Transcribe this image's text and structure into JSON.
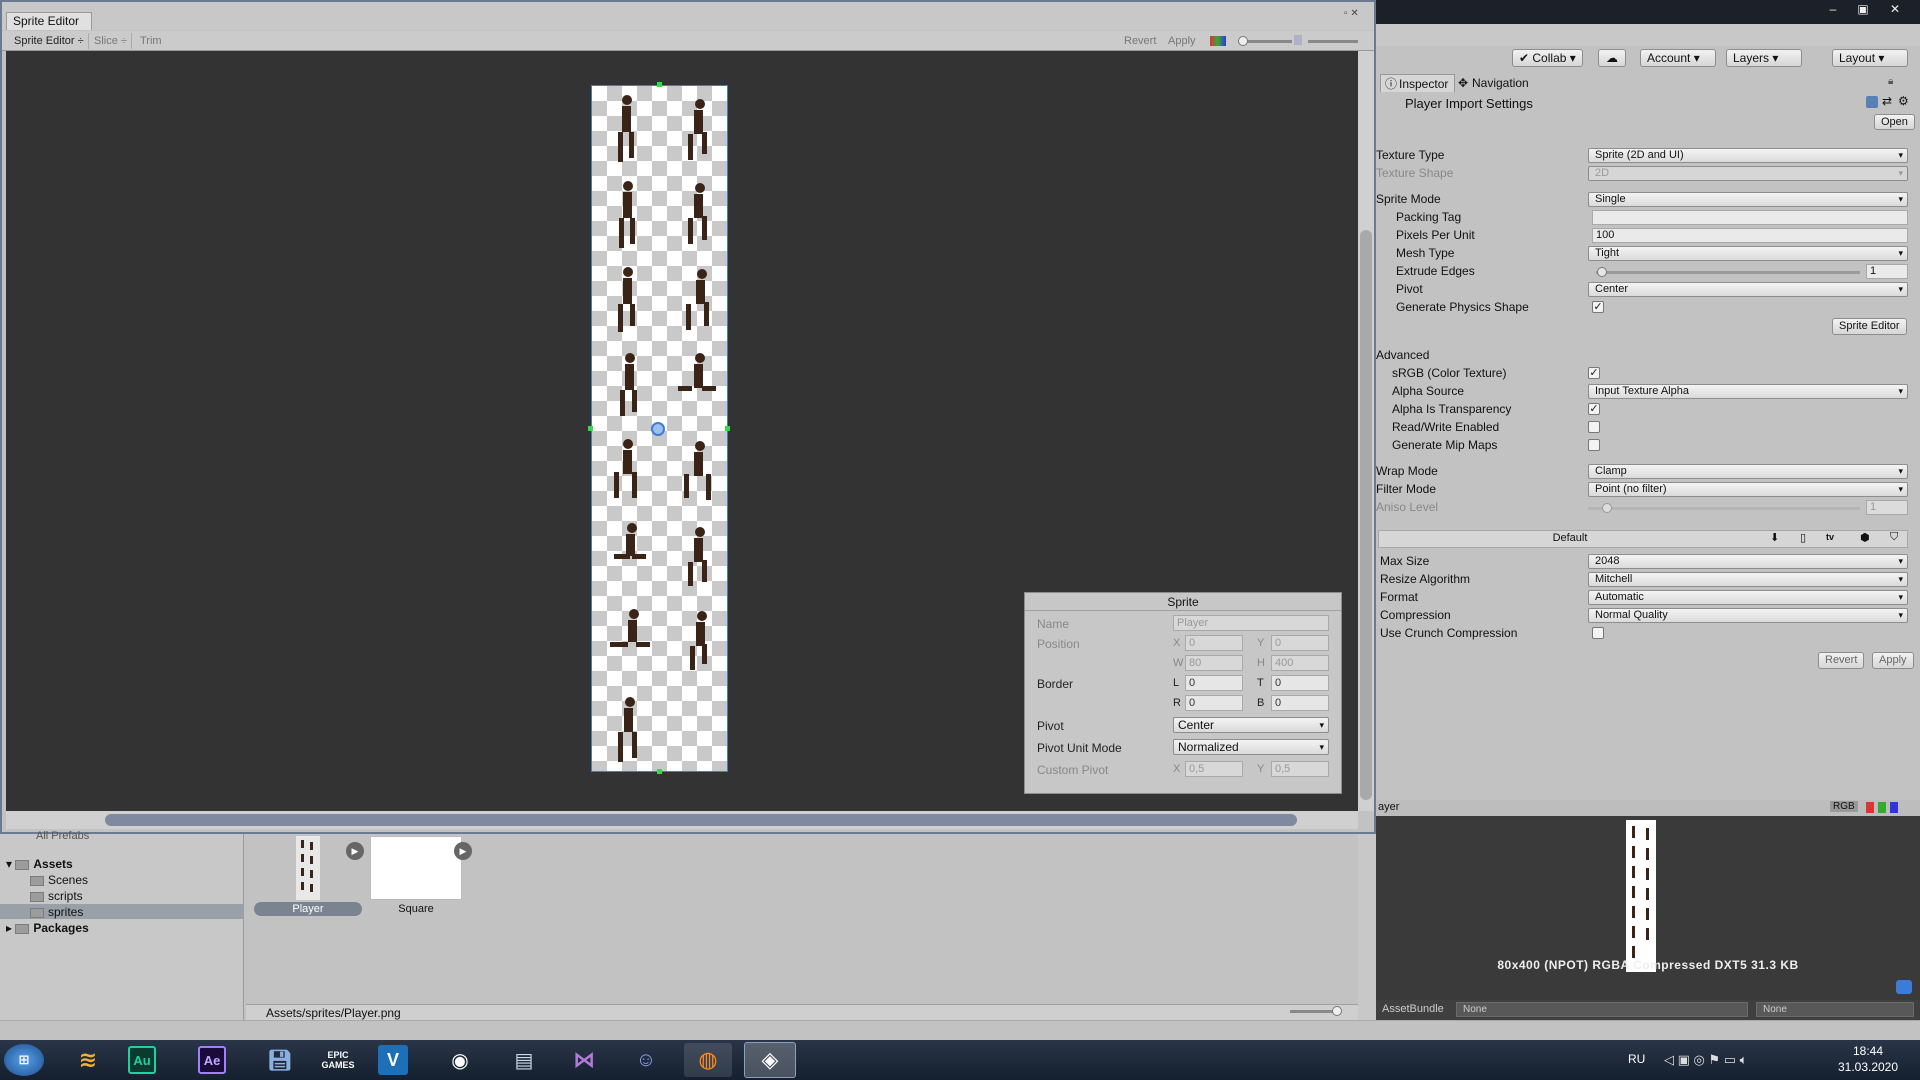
{
  "sprite_editor": {
    "tab_title": "Sprite Editor",
    "toolbar": {
      "mode": "Sprite Editor ÷",
      "slice": "Slice ÷",
      "trim": "Trim",
      "revert": "Revert",
      "apply": "Apply"
    },
    "sprite_panel": {
      "title": "Sprite",
      "name_label": "Name",
      "name_value": "Player",
      "position_label": "Position",
      "x_axis": "X",
      "x_value": "0",
      "y_axis": "Y",
      "y_value": "0",
      "w_axis": "W",
      "w_value": "80",
      "h_axis": "H",
      "h_value": "400",
      "border_label": "Border",
      "l_axis": "L",
      "l_value": "0",
      "t_axis": "T",
      "t_value": "0",
      "r_axis": "R",
      "r_value": "0",
      "b_axis": "B",
      "b_value": "0",
      "pivot_label": "Pivot",
      "pivot_value": "Center",
      "pivot_unit_label": "Pivot Unit Mode",
      "pivot_unit_value": "Normalized",
      "custom_pivot_label": "Custom Pivot",
      "cx_axis": "X",
      "cx_value": "0,5",
      "cy_axis": "Y",
      "cy_value": "0,5"
    }
  },
  "unity_toolbar": {
    "collab": "Collab ▾",
    "account": "Account ▾",
    "layers": "Layers ▾",
    "layout": "Layout ▾"
  },
  "inspector": {
    "tab_inspector": "Inspector",
    "tab_navigation": "Navigation",
    "title": "Player Import Settings",
    "open_button": "Open",
    "texture_type_label": "Texture Type",
    "texture_type_value": "Sprite (2D and UI)",
    "texture_shape_label": "Texture Shape",
    "texture_shape_value": "2D",
    "sprite_mode_label": "Sprite Mode",
    "sprite_mode_value": "Single",
    "packing_tag_label": "Packing Tag",
    "packing_tag_value": "",
    "ppu_label": "Pixels Per Unit",
    "ppu_value": "100",
    "mesh_type_label": "Mesh Type",
    "mesh_type_value": "Tight",
    "extrude_label": "Extrude Edges",
    "extrude_value": "1",
    "pivot_label": "Pivot",
    "pivot_value": "Center",
    "physics_label": "Generate Physics Shape",
    "sprite_editor_button": "Sprite Editor",
    "advanced_label": "Advanced",
    "srgb_label": "sRGB (Color Texture)",
    "alpha_source_label": "Alpha Source",
    "alpha_source_value": "Input Texture Alpha",
    "alpha_transp_label": "Alpha Is Transparency",
    "rw_label": "Read/Write Enabled",
    "mip_label": "Generate Mip Maps",
    "wrap_label": "Wrap Mode",
    "wrap_value": "Clamp",
    "filter_label": "Filter Mode",
    "filter_value": "Point (no filter)",
    "aniso_label": "Aniso Level",
    "aniso_value": "1",
    "platform_default": "Default",
    "max_size_label": "Max Size",
    "max_size_value": "2048",
    "resize_label": "Resize Algorithm",
    "resize_value": "Mitchell",
    "format_label": "Format",
    "format_value": "Automatic",
    "compression_label": "Compression",
    "compression_value": "Normal Quality",
    "crunch_label": "Use Crunch Compression",
    "revert_button": "Revert",
    "apply_button": "Apply",
    "preview_title": "ayer",
    "preview_channels": "RGB",
    "preview_info": "80x400 (NPOT)  RGBA Compressed DXT5   31.3 KB",
    "assetbundle_label": "AssetBundle",
    "assetbundle_value": "None",
    "assetbundle_variant": "None"
  },
  "project": {
    "tree": {
      "all_prefabs": "All Prefabs",
      "assets": "Assets",
      "scenes": "Scenes",
      "scripts": "scripts",
      "sprites": "sprites",
      "packages": "Packages"
    },
    "assets": [
      "Player",
      "Square"
    ],
    "path": "Assets/sprites/Player.png"
  },
  "taskbar": {
    "apps": [
      "Au",
      "Ae",
      "EPIC GAMES",
      "V"
    ],
    "lang": "RU",
    "time": "18:44",
    "date": "31.03.2020"
  }
}
